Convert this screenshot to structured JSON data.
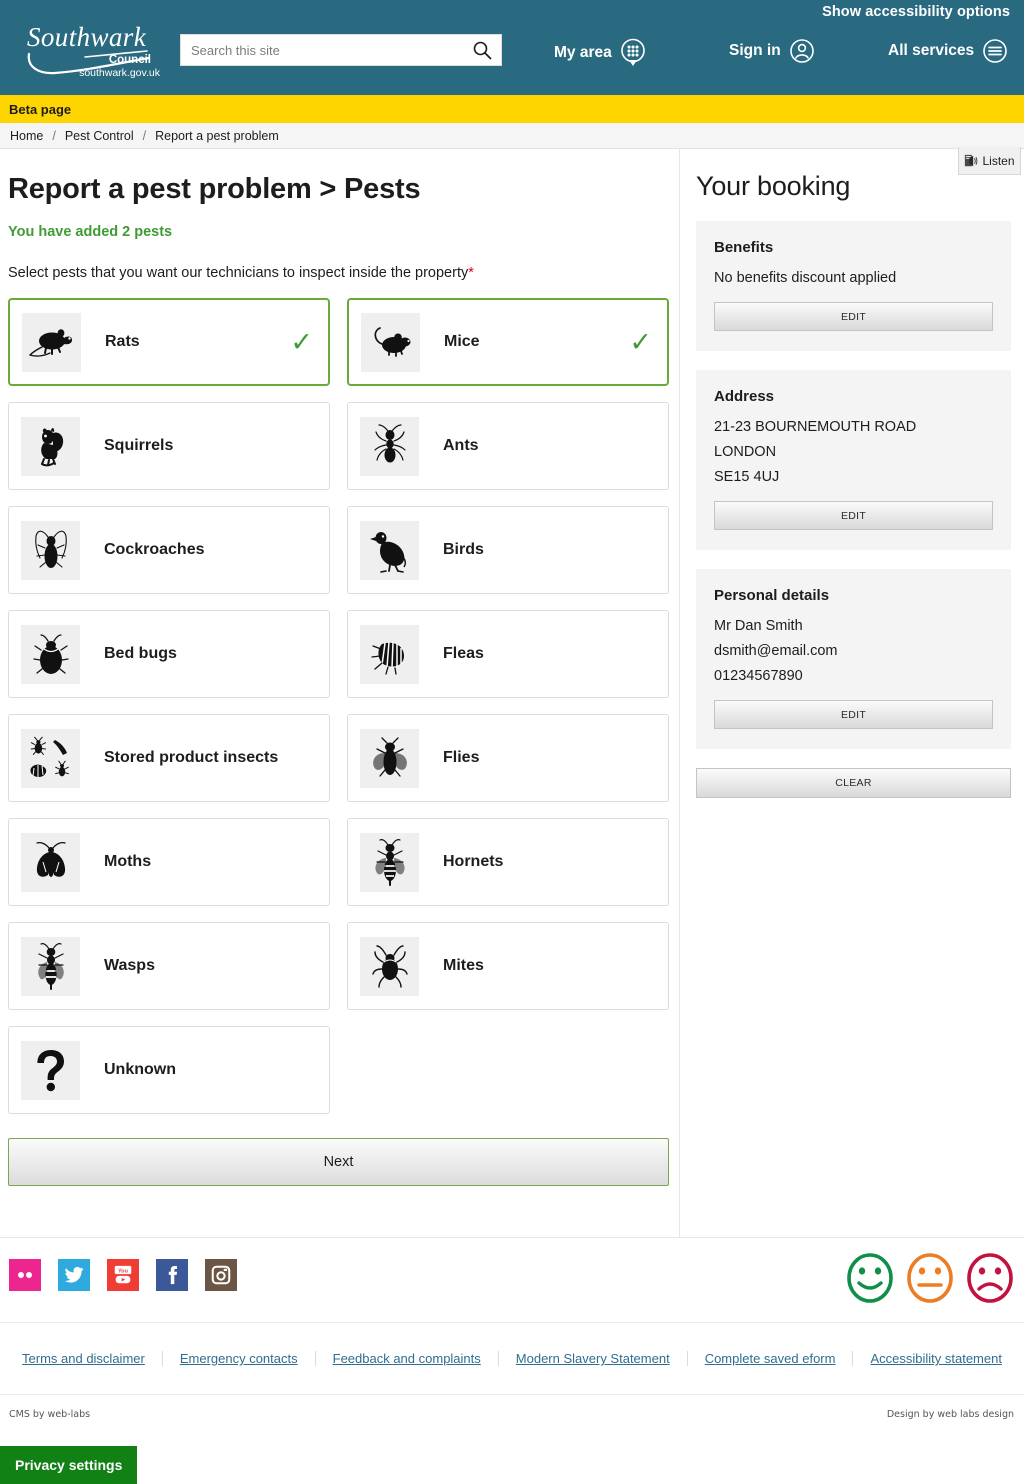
{
  "header": {
    "accessibility_link": "Show accessibility options",
    "logo": {
      "brand": "Southwark",
      "council": "Council",
      "domain": "southwark.gov.uk"
    },
    "search": {
      "placeholder": "Search this site",
      "value": "",
      "icon": "search-icon"
    },
    "nav": [
      {
        "label": "My area",
        "icon": "my-area-pin-icon"
      },
      {
        "label": "Sign in",
        "icon": "user-icon"
      },
      {
        "label": "All services",
        "icon": "hamburger-menu-icon"
      }
    ]
  },
  "beta": {
    "label": "Beta page"
  },
  "breadcrumb": {
    "items": [
      "Home",
      "Pest Control",
      "Report a pest problem"
    ],
    "separator": "/"
  },
  "main": {
    "title": "Report a pest problem > Pests",
    "added_message": "You have added 2 pests",
    "select_prompt": "Select pests that you want our technicians to inspect inside the property",
    "required_marker": "*",
    "tick_glyph": "✓",
    "pests": [
      {
        "label": "Rats",
        "icon": "rat-icon",
        "selected": true
      },
      {
        "label": "Mice",
        "icon": "mouse-icon",
        "selected": true
      },
      {
        "label": "Squirrels",
        "icon": "squirrel-icon",
        "selected": false
      },
      {
        "label": "Ants",
        "icon": "ant-icon",
        "selected": false
      },
      {
        "label": "Cockroaches",
        "icon": "cockroach-icon",
        "selected": false
      },
      {
        "label": "Birds",
        "icon": "bird-icon",
        "selected": false
      },
      {
        "label": "Bed bugs",
        "icon": "bedbug-icon",
        "selected": false
      },
      {
        "label": "Fleas",
        "icon": "flea-icon",
        "selected": false
      },
      {
        "label": "Stored product insects",
        "icon": "stored-product-insects-icon",
        "selected": false
      },
      {
        "label": "Flies",
        "icon": "fly-icon",
        "selected": false
      },
      {
        "label": "Moths",
        "icon": "moth-icon",
        "selected": false
      },
      {
        "label": "Hornets",
        "icon": "hornet-icon",
        "selected": false
      },
      {
        "label": "Wasps",
        "icon": "wasp-icon",
        "selected": false
      },
      {
        "label": "Mites",
        "icon": "mite-icon",
        "selected": false
      },
      {
        "label": "Unknown",
        "icon": "question-mark-icon",
        "selected": false
      }
    ],
    "next_label": "Next"
  },
  "aside": {
    "listen_label": "Listen",
    "listen_icon": "speaker-icon",
    "title": "Your booking",
    "benefits": {
      "heading": "Benefits",
      "text": "No benefits discount applied",
      "edit_label": "EDIT"
    },
    "address": {
      "heading": "Address",
      "line1": "21-23 BOURNEMOUTH ROAD",
      "line2": "LONDON",
      "line3": "SE15 4UJ",
      "edit_label": "EDIT"
    },
    "personal": {
      "heading": "Personal details",
      "name": "Mr Dan Smith",
      "email": "dsmith@email.com",
      "phone": "01234567890",
      "edit_label": "EDIT"
    },
    "clear_label": "CLEAR"
  },
  "footer": {
    "socials": [
      {
        "name": "flickr-icon",
        "color": "#ec268f"
      },
      {
        "name": "twitter-icon",
        "color": "#2eaadf"
      },
      {
        "name": "youtube-icon",
        "color": "#ef3d36"
      },
      {
        "name": "facebook-icon",
        "color": "#3b5998"
      },
      {
        "name": "instagram-icon",
        "color": "#6d5545"
      }
    ],
    "faces": [
      {
        "name": "happy-face-icon",
        "color": "#0f8f48"
      },
      {
        "name": "neutral-face-icon",
        "color": "#ec7d25"
      },
      {
        "name": "sad-face-icon",
        "color": "#c4123f"
      }
    ],
    "links": [
      "Terms and disclaimer",
      "Emergency contacts",
      "Feedback and complaints",
      "Modern Slavery Statement",
      "Complete saved eform",
      "Accessibility statement"
    ],
    "credit_left": "CMS by web-labs",
    "credit_right": "Design by web labs design",
    "privacy_label": "Privacy settings"
  },
  "colors": {
    "header_teal": "#2a6a80",
    "beta_yellow": "#ffd500",
    "selected_green": "#6aaa3a",
    "success_green": "#3f9c35",
    "required_red": "#e4002b",
    "link_blue": "#2f6e8f",
    "privacy_green": "#118015"
  }
}
